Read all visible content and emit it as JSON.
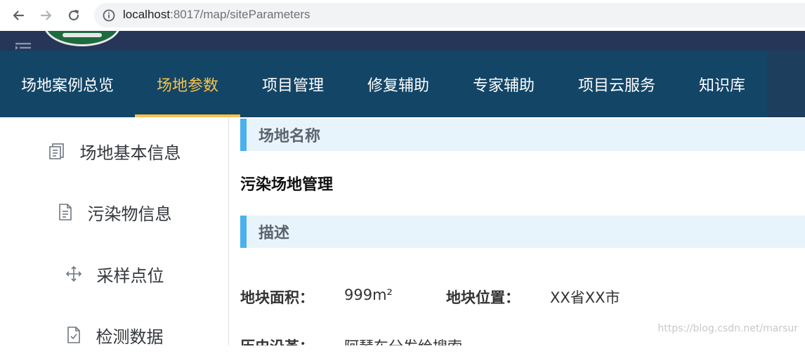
{
  "browser": {
    "url_host": "localhost",
    "url_path": ":8017/map/siteParameters"
  },
  "top_nav": {
    "items": [
      {
        "label": "场地案例总览",
        "active": false
      },
      {
        "label": "场地参数",
        "active": true
      },
      {
        "label": "项目管理",
        "active": false
      },
      {
        "label": "修复辅助",
        "active": false
      },
      {
        "label": "专家辅助",
        "active": false
      },
      {
        "label": "项目云服务",
        "active": false
      },
      {
        "label": "知识库",
        "active": false
      }
    ],
    "active_color": "#f6c34b",
    "background": "#134566"
  },
  "sidebar": {
    "items": [
      {
        "label": "场地基本信息",
        "icon": "copy-document-icon"
      },
      {
        "label": "污染物信息",
        "icon": "document-text-icon"
      },
      {
        "label": "采样点位",
        "icon": "move-arrows-icon"
      },
      {
        "label": "检测数据",
        "icon": "document-check-icon"
      }
    ]
  },
  "main": {
    "site_name_header": "场地名称",
    "site_name_value": "污染场地管理",
    "description_header": "描述",
    "fields": [
      {
        "label": "地块面积：",
        "value": "999m²"
      },
      {
        "label": "地块位置：",
        "value": "XX省XX市"
      }
    ],
    "history_label": "历史沿革：",
    "history_value": "阿琴车分发给搜索",
    "accent_color": "#4ab0ee"
  },
  "watermark": "https://blog.csdn.net/marsur"
}
